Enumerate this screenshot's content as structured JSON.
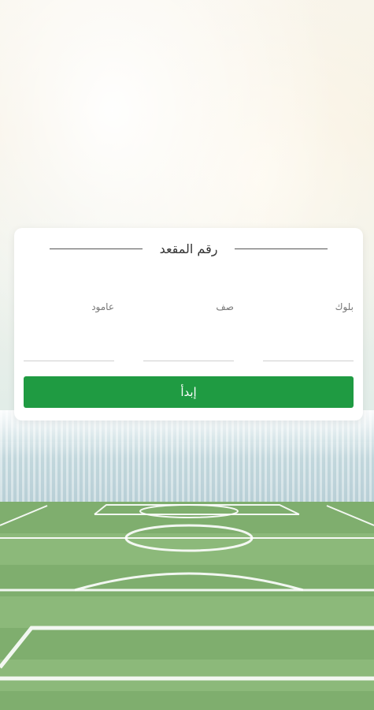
{
  "seat_form": {
    "title": "رقم المقعد",
    "fields": {
      "block": {
        "label": "بلوك",
        "value": ""
      },
      "row": {
        "label": "صف",
        "value": ""
      },
      "column": {
        "label": "عامود",
        "value": ""
      }
    },
    "start_button_label": "إبدأ"
  },
  "colors": {
    "accent": "#1f9b42",
    "card_background": "#ffffff"
  }
}
